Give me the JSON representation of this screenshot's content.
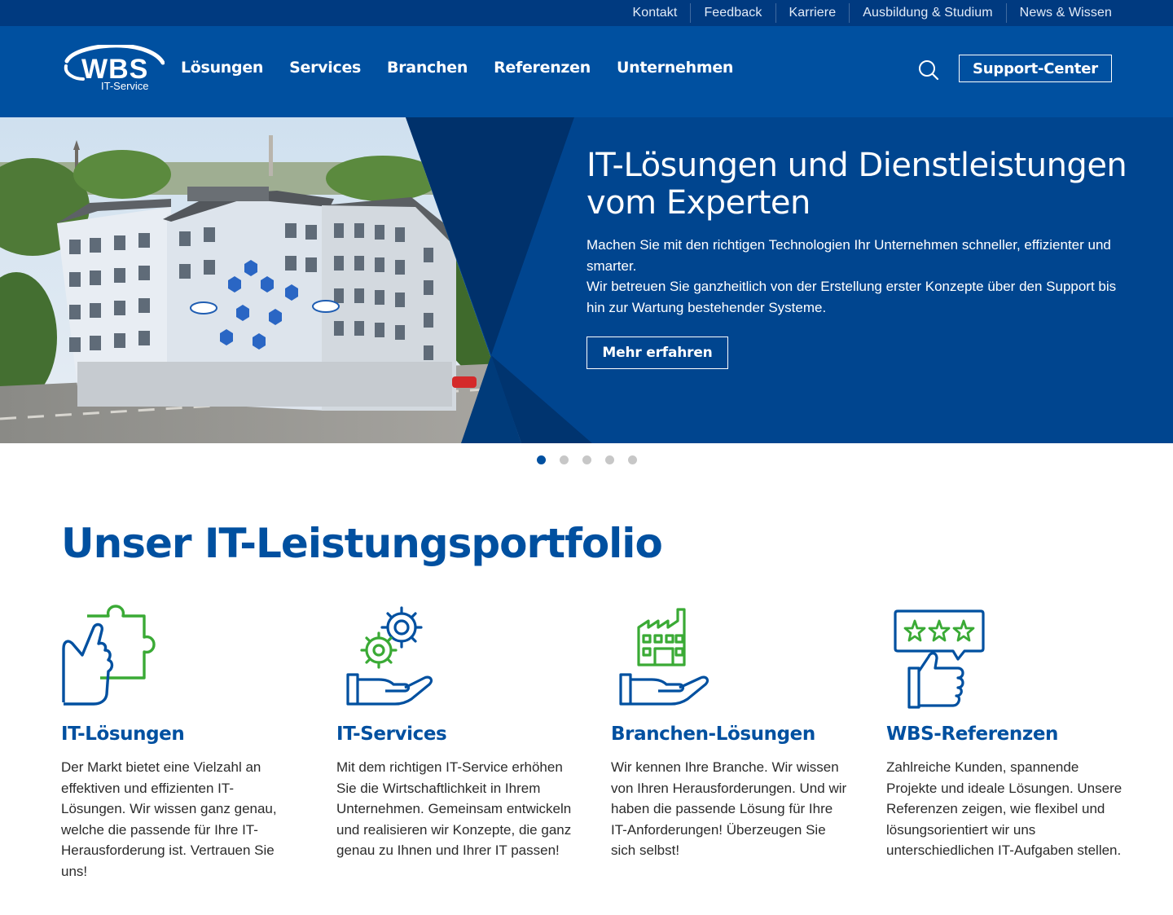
{
  "topbar": {
    "links": [
      "Kontakt",
      "Feedback",
      "Karriere",
      "Ausbildung & Studium",
      "News & Wissen"
    ]
  },
  "header": {
    "logo_text": "WBS",
    "logo_sub": "IT-Service",
    "nav": [
      "Lösungen",
      "Services",
      "Branchen",
      "Referenzen",
      "Unternehmen"
    ],
    "support_label": "Support-Center"
  },
  "hero": {
    "title": "IT-Lösungen und Dienstleistungen vom Experten",
    "text_1": "Machen Sie mit den richtigen Technologien Ihr Unternehmen schneller, effizienter und smarter.",
    "text_2": "Wir betreuen Sie ganzheitlich von der Erstellung erster Konzepte über den Support bis hin zur Wartung bestehender Systeme.",
    "cta_label": "Mehr erfahren",
    "slides_total": 5,
    "active_slide": 1
  },
  "portfolio": {
    "title": "Unser IT-Leistungsportfolio",
    "cards": [
      {
        "icon": "puzzle-hand-icon",
        "title": "IT-Lösungen",
        "text": "Der Markt bietet eine Vielzahl an effektiven und effizienten IT-Lösungen. Wir wissen ganz genau, welche die passende für Ihre IT-Herausforderung ist. Vertrauen Sie uns!"
      },
      {
        "icon": "gears-hand-icon",
        "title": "IT-Services",
        "text": "Mit dem richtigen IT-Service erhöhen Sie die Wirtschaftlichkeit in Ihrem Unternehmen. Gemeinsam entwickeln und realisieren wir Konzepte, die ganz genau zu Ihnen und Ihrer IT passen!"
      },
      {
        "icon": "factory-hand-icon",
        "title": "Branchen-Lösungen",
        "text": "Wir kennen Ihre Branche. Wir wissen von Ihren Herausforderungen. Und wir haben die passende Lösung für Ihre IT-Anforderungen! Überzeugen Sie sich selbst!"
      },
      {
        "icon": "thumbs-up-stars-icon",
        "title": "WBS-Referenzen",
        "text": "Zahlreiche Kunden, spannende Projekte und ideale Lösungen. Unsere Referenzen zeigen, wie flexibel und lösungsorientiert wir uns unterschiedlichen IT-Aufgaben stellen."
      }
    ]
  },
  "colors": {
    "brand_blue": "#0050a0",
    "topbar_blue": "#003a80",
    "icon_green": "#3aaa35",
    "dot_inactive": "#c7c7c7"
  }
}
